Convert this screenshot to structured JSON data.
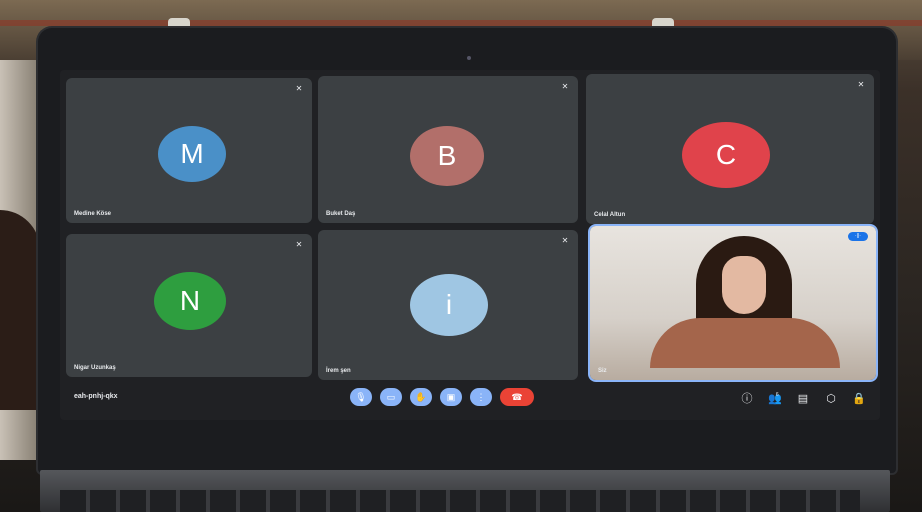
{
  "meeting": {
    "code": "eah-pnhj-qkx",
    "participants": [
      {
        "name": "Medine Köse",
        "initial": "M",
        "color": "#4a90c8",
        "mic_muted": true
      },
      {
        "name": "Buket Daş",
        "initial": "B",
        "color": "#b26f6a",
        "mic_muted": true
      },
      {
        "name": "Celal Altun",
        "initial": "C",
        "color": "#e0434b",
        "mic_muted": true
      },
      {
        "name": "Nigar Uzunkaş",
        "initial": "N",
        "color": "#2e9e3f",
        "mic_muted": true
      },
      {
        "name": "İrem şen",
        "initial": "i",
        "color": "#9fc6e3",
        "mic_muted": true
      },
      {
        "name": "Siz",
        "initial": "",
        "color": "",
        "mic_muted": false
      }
    ],
    "controls": [
      "mic-icon",
      "camera-icon",
      "hand-icon",
      "present-icon",
      "more-icon",
      "end-call-icon"
    ],
    "right_icons": [
      "info-icon",
      "people-icon",
      "chat-icon",
      "activities-icon",
      "lock-icon"
    ],
    "people_count": "6",
    "speaking_badge": "·||·"
  }
}
